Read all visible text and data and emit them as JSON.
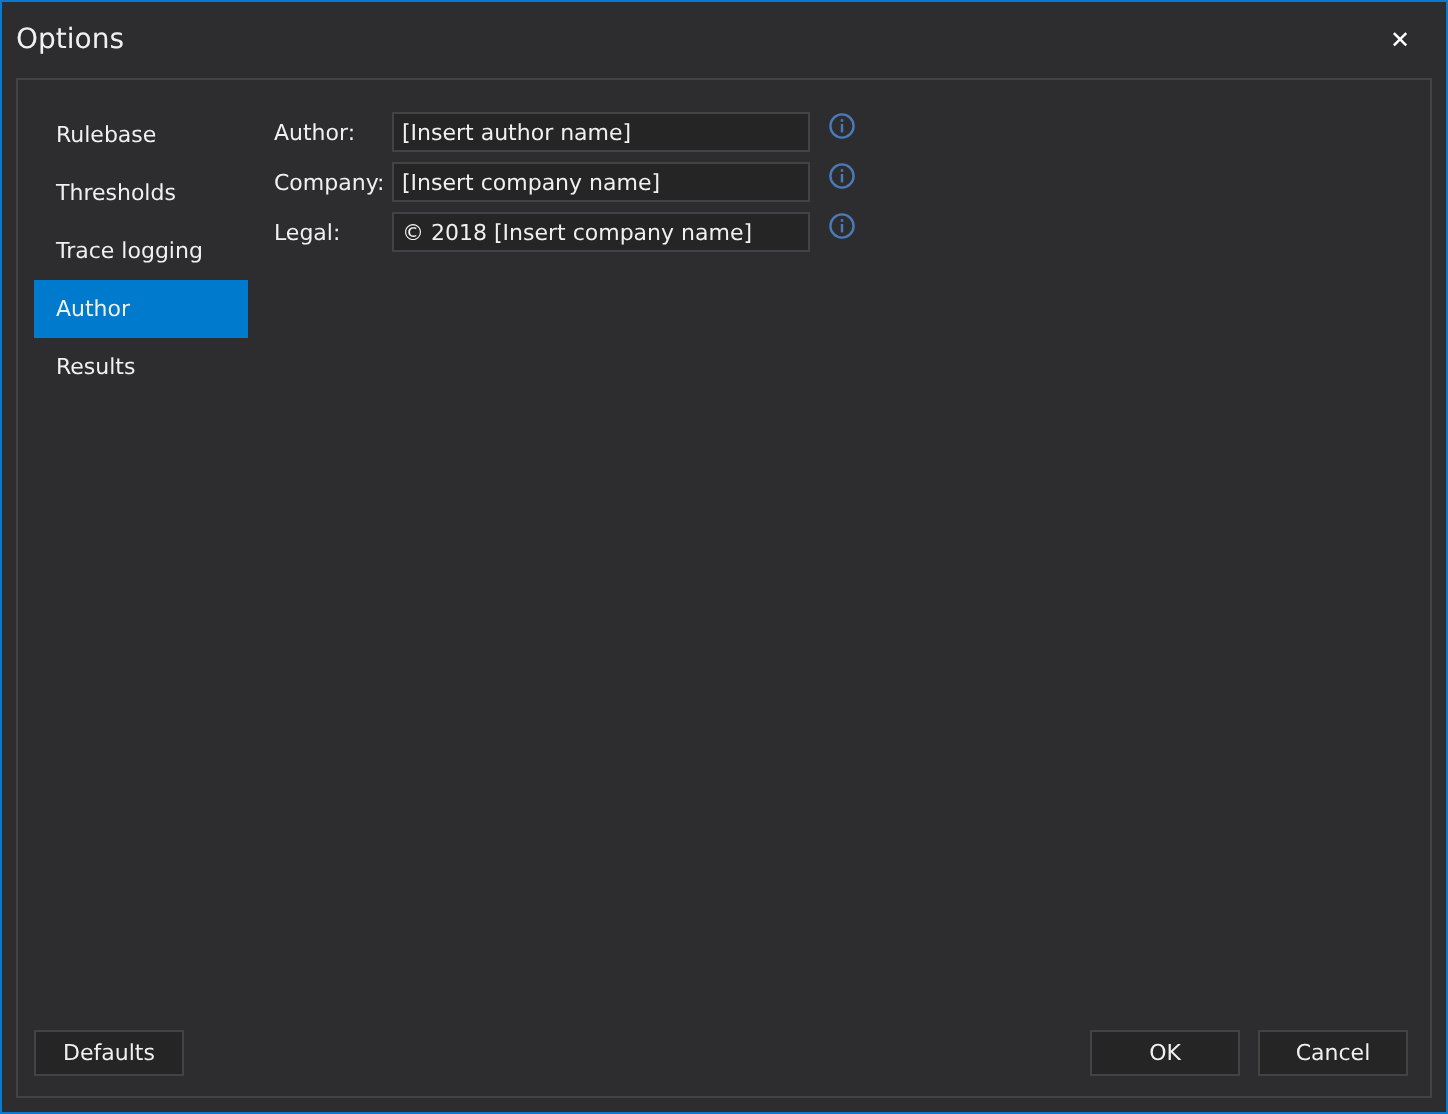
{
  "window": {
    "title": "Options",
    "close": "✕"
  },
  "sidebar": {
    "items": [
      {
        "label": "Rulebase",
        "selected": false
      },
      {
        "label": "Thresholds",
        "selected": false
      },
      {
        "label": "Trace logging",
        "selected": false
      },
      {
        "label": "Author",
        "selected": true
      },
      {
        "label": "Results",
        "selected": false
      }
    ]
  },
  "fields": [
    {
      "label": "Author:",
      "value": "[Insert author name]"
    },
    {
      "label": "Company:",
      "value": "[Insert company name]"
    },
    {
      "label": "Legal:",
      "value": "© 2018 [Insert company name]"
    }
  ],
  "buttons": {
    "left": [
      "Defaults"
    ],
    "right": [
      "OK",
      "Cancel"
    ]
  }
}
